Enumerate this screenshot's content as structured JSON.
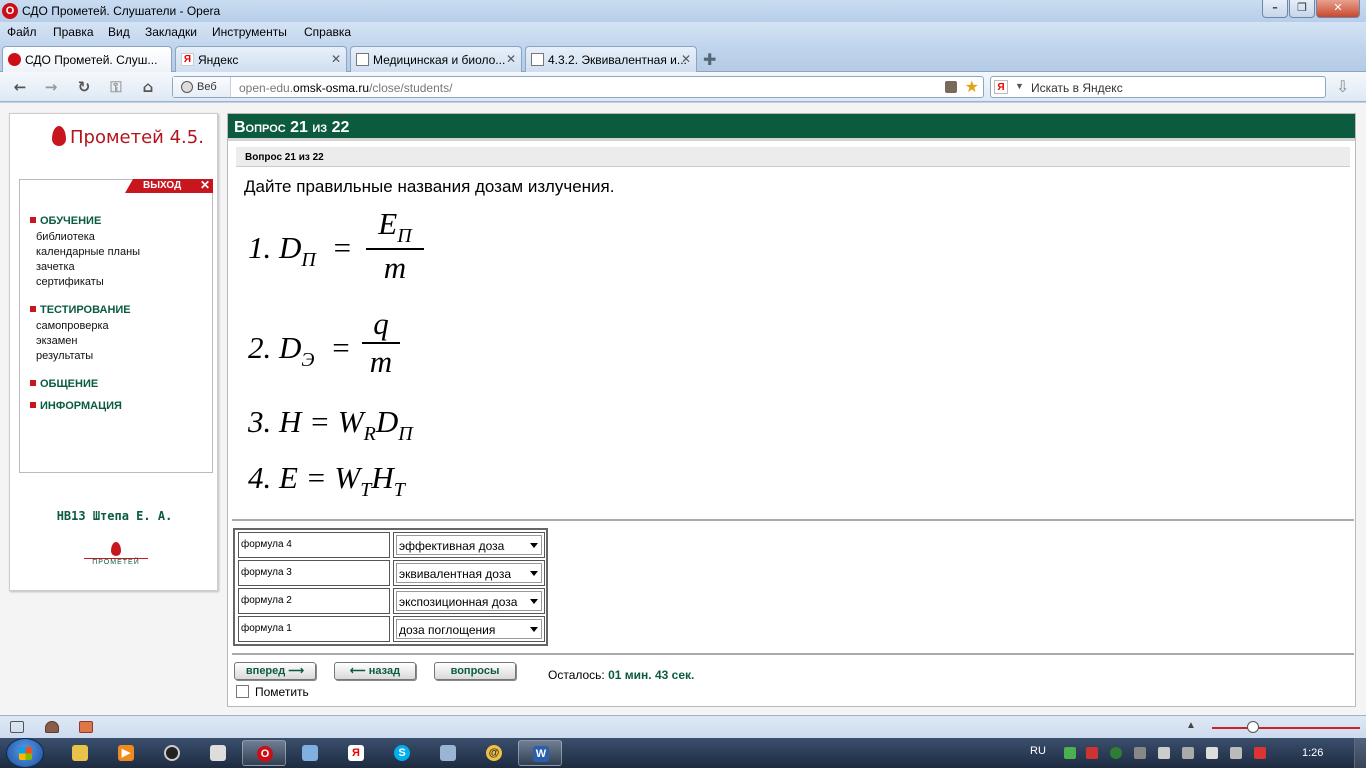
{
  "window": {
    "title": "СДО Прометей. Слушатели - Opera"
  },
  "menubar": {
    "items": [
      "Файл",
      "Правка",
      "Вид",
      "Закладки",
      "Инструменты",
      "Справка"
    ]
  },
  "tabs": [
    {
      "label": "СДО Прометей. Слуш...",
      "icon": "opera-icon",
      "active": true
    },
    {
      "label": "Яндекс",
      "icon": "yandex-icon",
      "active": false
    },
    {
      "label": "Медицинская и биоло...",
      "icon": "document-icon",
      "active": false
    },
    {
      "label": "4.3.2. Эквивалентная и...",
      "icon": "document-icon",
      "active": false
    }
  ],
  "address_bar": {
    "web_label": "Веб",
    "url_prefix": "open-edu.",
    "url_domain": "omsk-osma.ru",
    "url_path": "/close/students/"
  },
  "search": {
    "placeholder": "Искать в Яндекс",
    "engine_glyph": "Я"
  },
  "sidebar": {
    "logo_text": "Прометей 4.5.",
    "exit_label": "ВЫХОД",
    "sections": [
      {
        "title": "ОБУЧЕНИЕ",
        "links": [
          "библиотека",
          "календарные планы",
          "зачетка",
          "сертификаты"
        ]
      },
      {
        "title": "ТЕСТИРОВАНИЕ",
        "links": [
          "самопроверка",
          "экзамен",
          "результаты"
        ]
      },
      {
        "title": "ОБЩЕНИЕ",
        "links": []
      },
      {
        "title": "ИНФОРМАЦИЯ",
        "links": []
      }
    ],
    "user": "НВ13 Штепа Е. А.",
    "bottom_logo_text": "ПРОМЕТЕЙ"
  },
  "question": {
    "header": "Вопрос 21 из 22",
    "subheader": "Вопрос 21 из 22",
    "text": "Дайте правильные названия дозам излучения.",
    "formulas": [
      {
        "num": "1.",
        "lhs": "D",
        "lhs_sub": "П",
        "numerator": "E",
        "numerator_sub": "П",
        "denominator": "m"
      },
      {
        "num": "2.",
        "lhs": "D",
        "lhs_sub": "Э",
        "numerator": "q",
        "numerator_sub": "",
        "denominator": "m"
      },
      {
        "num": "3.",
        "expr": "H = W",
        "sub1": "R",
        "mid": "D",
        "sub2": "П"
      },
      {
        "num": "4.",
        "expr": "E = W",
        "sub1": "T",
        "mid": "H",
        "sub2": "T"
      }
    ],
    "matches": [
      {
        "label": "формула 4",
        "value": "эффективная доза"
      },
      {
        "label": "формула 3",
        "value": "эквивалентная доза"
      },
      {
        "label": "формула 2",
        "value": "экспозиционная доза"
      },
      {
        "label": "формула 1",
        "value": "доза поглощения"
      }
    ],
    "buttons": {
      "forward": "вперед ⟶",
      "back": "⟵ назад",
      "questions": "вопросы"
    },
    "remaining_label": "Осталось:",
    "remaining_value": "01 мин. 43 сек.",
    "mark_label": "Пометить"
  },
  "taskbar": {
    "language": "RU",
    "clock": "1:26"
  }
}
